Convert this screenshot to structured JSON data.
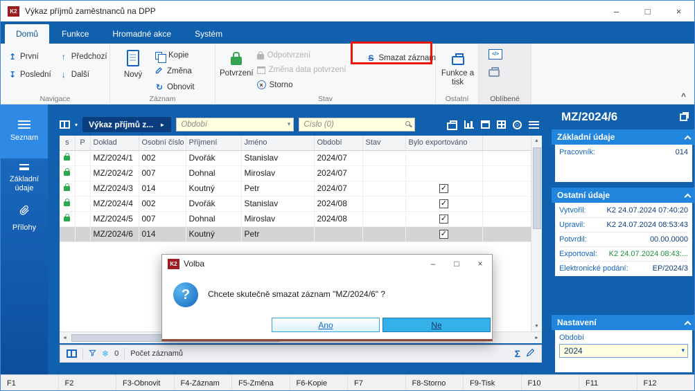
{
  "window": {
    "title": "Výkaz příjmů zaměstnanců na DPP"
  },
  "icons": {
    "k2": "K2",
    "minimize": "–",
    "maximize": "□",
    "close": "×",
    "first": "↥",
    "last": "↧",
    "up": "↑",
    "down": "↓",
    "refresh": "↻",
    "s_delete": "S",
    "storno_x": "×",
    "check": "✓",
    "play": "►",
    "chevron_down": "▾",
    "collapse": "^",
    "sigma": "Σ",
    "snowflake": "❄",
    "code": "</>",
    "arrow_up": "▲",
    "arrow_down": "▼",
    "arrow_left": "◄",
    "arrow_right": "►",
    "question": "?"
  },
  "ribbon": {
    "tabs": [
      {
        "label": "Domů"
      },
      {
        "label": "Funkce"
      },
      {
        "label": "Hromadné akce"
      },
      {
        "label": "Systém"
      }
    ],
    "groups": {
      "navigace": {
        "label": "Navigace",
        "first": "První",
        "previous": "Předchozí",
        "last": "Poslední",
        "next": "Další"
      },
      "zaznam": {
        "label": "Záznam",
        "new": "Nový",
        "copy": "Kopie",
        "change": "Změna",
        "refresh": "Obnovit"
      },
      "stav": {
        "label": "Stav",
        "confirm": "Potvrzení",
        "unconfirm": "Odpotvrzení",
        "change_date": "Změna data potvrzení",
        "storno": "Storno",
        "delete": "Smazat záznam"
      },
      "ostatni": {
        "label": "Ostatní",
        "functions_print": "Funkce a tisk"
      },
      "oblibene": {
        "label": "Oblíbené"
      }
    }
  },
  "sidebar": {
    "items": [
      {
        "label": "Seznam"
      },
      {
        "label": "Základní údaje"
      },
      {
        "label": "Přílohy"
      }
    ]
  },
  "grid": {
    "view_title": "Výkaz příjmů z...",
    "filters": {
      "period_placeholder": "Období",
      "number_placeholder": "Číslo (0)"
    },
    "columns": [
      "s",
      "P",
      "Doklad",
      "Osobní číslo",
      "Příjmení",
      "Jméno",
      "Období",
      "Stav",
      "Bylo exportováno"
    ],
    "rows": [
      {
        "doklad": "MZ/2024/1",
        "osobni": "002",
        "prijmeni": "Dvořák",
        "jmeno": "Stanislav",
        "obdobi": "2024/07",
        "stav": "",
        "locked": true,
        "exported": false,
        "selected": false
      },
      {
        "doklad": "MZ/2024/2",
        "osobni": "007",
        "prijmeni": "Dohnal",
        "jmeno": "Miroslav",
        "obdobi": "2024/07",
        "stav": "",
        "locked": true,
        "exported": false,
        "selected": false
      },
      {
        "doklad": "MZ/2024/3",
        "osobni": "014",
        "prijmeni": "Koutný",
        "jmeno": "Petr",
        "obdobi": "2024/07",
        "stav": "",
        "locked": true,
        "exported": true,
        "selected": false
      },
      {
        "doklad": "MZ/2024/4",
        "osobni": "002",
        "prijmeni": "Dvořák",
        "jmeno": "Stanislav",
        "obdobi": "2024/08",
        "stav": "",
        "locked": true,
        "exported": true,
        "selected": false
      },
      {
        "doklad": "MZ/2024/5",
        "osobni": "007",
        "prijmeni": "Dohnal",
        "jmeno": "Miroslav",
        "obdobi": "2024/08",
        "stav": "",
        "locked": true,
        "exported": true,
        "selected": false
      },
      {
        "doklad": "MZ/2024/6",
        "osobni": "014",
        "prijmeni": "Koutný",
        "jmeno": "Petr",
        "obdobi": "",
        "stav": "",
        "locked": false,
        "exported": true,
        "selected": true
      }
    ],
    "footer": {
      "filter_count": "0",
      "count_label": "Počet záznamů"
    }
  },
  "dialog": {
    "title": "Volba",
    "message": "Chcete skutečně smazat záznam \"MZ/2024/6\" ?",
    "yes": "Ano",
    "no": "Ne"
  },
  "detail": {
    "record_id": "MZ/2024/6",
    "basic": {
      "title": "Základní údaje",
      "rows": [
        {
          "label": "Pracovník:",
          "value": "014"
        }
      ]
    },
    "other": {
      "title": "Ostatní údaje",
      "rows": [
        {
          "label": "Vytvořil:",
          "value": "K2 24.07.2024 07:40:20"
        },
        {
          "label": "Upravil:",
          "value": "K2 24.07.2024 08:53:43"
        },
        {
          "label": "Potvrdil:",
          "value": "00.00.0000"
        },
        {
          "label": "Exportoval:",
          "value": "K2 24.07.2024 08:43:..."
        },
        {
          "label": "Elektronické podání:",
          "value": "EP/2024/3"
        }
      ]
    },
    "settings": {
      "title": "Nastavení",
      "period_label": "Období",
      "period_value": "2024"
    }
  },
  "statusbar": {
    "keys": [
      "F1",
      "F2",
      "F3-Obnovit",
      "F4-Záznam",
      "F5-Změna",
      "F6-Kopie",
      "F7",
      "F8-Storno",
      "F9-Tisk",
      "F10",
      "F11",
      "F12"
    ]
  },
  "colors": {
    "chrome_blue": "#1160ae",
    "panel_bar_blue": "#2185dd",
    "accent_cyan": "#35b1ea",
    "lock_green": "#35a452",
    "annotation_red": "#e8150d",
    "exported_green": "#1e8e3e",
    "input_yellow": "#ffffdf",
    "selected_row_gray": "#d4d4d4",
    "view_pill_navy": "#0b3e7e"
  }
}
